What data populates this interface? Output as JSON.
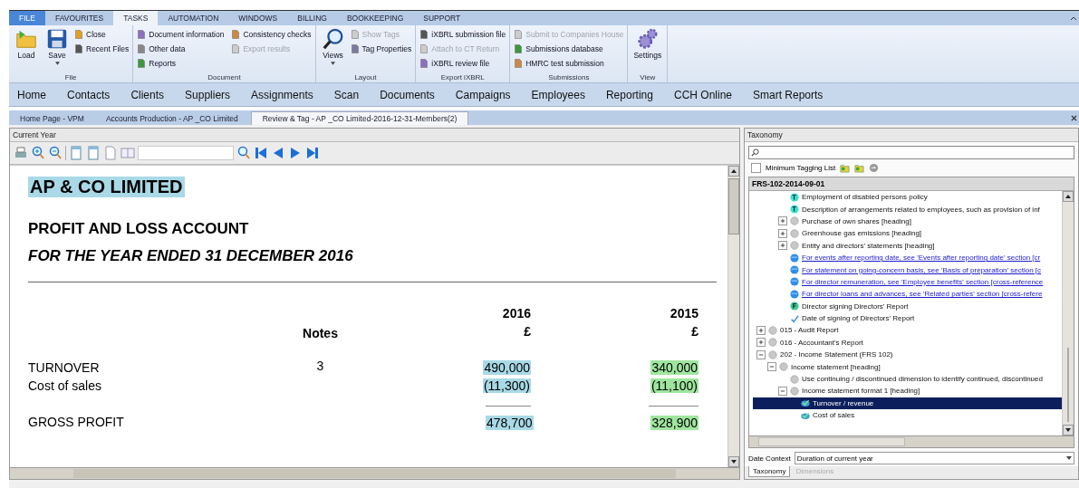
{
  "menu_tabs": [
    {
      "label": "FILE",
      "kind": "file",
      "selected": false
    },
    {
      "label": "FAVOURITES",
      "kind": "tab",
      "selected": false
    },
    {
      "label": "TASKS",
      "kind": "tab",
      "selected": true
    },
    {
      "label": "AUTOMATION",
      "kind": "tab",
      "selected": false
    },
    {
      "label": "WINDOWS",
      "kind": "tab",
      "selected": false
    },
    {
      "label": "BILLING",
      "kind": "tab",
      "selected": false
    },
    {
      "label": "BOOKKEEPING",
      "kind": "tab",
      "selected": false
    },
    {
      "label": "SUPPORT",
      "kind": "tab",
      "selected": false
    }
  ],
  "ribbon_groups": [
    {
      "label": "File",
      "buttons": [
        {
          "label": "Load",
          "kind": "large",
          "disabled": false
        },
        {
          "label": "Save",
          "kind": "large",
          "dropdown": true,
          "disabled": false
        },
        {
          "label": "Close",
          "kind": "small",
          "disabled": false
        },
        {
          "label": "Recent Files",
          "kind": "small",
          "disabled": false
        }
      ]
    },
    {
      "label": "Document",
      "buttons": [
        {
          "label": "Document information",
          "kind": "small",
          "disabled": false
        },
        {
          "label": "Other data",
          "kind": "small",
          "disabled": false
        },
        {
          "label": "Reports",
          "kind": "small",
          "disabled": false
        },
        {
          "label": "Consistency checks",
          "kind": "small",
          "disabled": false
        },
        {
          "label": "Export results",
          "kind": "small",
          "disabled": true
        }
      ]
    },
    {
      "label": "Layout",
      "buttons": [
        {
          "label": "Views",
          "kind": "large",
          "dropdown": true,
          "disabled": false
        },
        {
          "label": "Show Tags",
          "kind": "small",
          "disabled": true
        },
        {
          "label": "Tag Properties",
          "kind": "small",
          "disabled": false
        }
      ]
    },
    {
      "label": "Export iXBRL",
      "buttons": [
        {
          "label": "iXBRL submission file",
          "kind": "small",
          "disabled": false
        },
        {
          "label": "Attach to CT Return",
          "kind": "small",
          "disabled": true
        },
        {
          "label": "iXBRL review file",
          "kind": "small",
          "disabled": false
        }
      ]
    },
    {
      "label": "Submissions",
      "buttons": [
        {
          "label": "Submit to Companies House",
          "kind": "small",
          "disabled": true
        },
        {
          "label": "Submissions database",
          "kind": "small",
          "disabled": false
        },
        {
          "label": "HMRC test submission",
          "kind": "small",
          "disabled": false
        }
      ]
    },
    {
      "label": "View",
      "buttons": [
        {
          "label": "Settings",
          "kind": "large",
          "disabled": false
        }
      ]
    }
  ],
  "nav": [
    "Home",
    "Contacts",
    "Clients",
    "Suppliers",
    "Assignments",
    "Scan",
    "Documents",
    "Campaigns",
    "Employees",
    "Reporting",
    "CCH Online",
    "Smart Reports"
  ],
  "doc_tabs": [
    {
      "label": "Home Page - VPM",
      "selected": false
    },
    {
      "label": "Accounts Production - AP _CO Limited",
      "selected": false
    },
    {
      "label": "Review & Tag - AP _CO Limited-2016-12-31-Members(2)",
      "selected": true
    }
  ],
  "document": {
    "panel_title": "Current Year",
    "company": {
      "text": "AP & CO LIMITED",
      "tagged": true
    },
    "heading": "PROFIT AND LOSS ACCOUNT",
    "subheading": "FOR THE YEAR ENDED 31 DECEMBER 2016",
    "notes_label": "Notes",
    "columns": [
      {
        "year": "2016",
        "unit": "£",
        "color": "#a9d9e6"
      },
      {
        "year": "2015",
        "unit": "£",
        "color": "#9fe59f"
      }
    ],
    "rows": [
      {
        "label": "TURNOVER",
        "kind": "line",
        "note": "3",
        "values": [
          {
            "text": "490,000",
            "tagged": true
          },
          {
            "text": "340,000",
            "tagged": true
          }
        ]
      },
      {
        "label": "Cost of sales",
        "kind": "line",
        "values": [
          {
            "text": "(11,300)",
            "tagged": true
          },
          {
            "text": "(11,100)",
            "tagged": true
          }
        ]
      },
      {
        "label": "GROSS PROFIT",
        "kind": "total",
        "values": [
          {
            "text": "478,700",
            "tagged": true
          },
          {
            "text": "328,900",
            "tagged": true
          }
        ]
      }
    ]
  },
  "taxonomy": {
    "panel_title": "Taxonomy",
    "minimum_tagging_list": {
      "label": "Minimum Tagging List",
      "checked": false
    },
    "tree": {
      "root": "FRS-102-2014-09-01",
      "items": [
        {
          "children": [
            {
              "children": [
                {
                  "label": "Employment of disabled persons policy",
                  "kind": "text",
                  "selected": false
                },
                {
                  "label": "Description of arrangements related to employees, such as provision of inf",
                  "kind": "text",
                  "selected": false
                },
                {
                  "label": "Purchase of own shares [heading]",
                  "kind": "heading",
                  "expanded": false,
                  "selected": false
                },
                {
                  "label": "Greenhouse gas emissions [heading]",
                  "kind": "heading",
                  "expanded": false,
                  "selected": false
                },
                {
                  "label": "Entity and directors' statements [heading]",
                  "kind": "heading",
                  "expanded": false,
                  "selected": false
                },
                {
                  "label": "For events after reporting date, see 'Events after reporting date' section [cr",
                  "kind": "link",
                  "selected": false
                },
                {
                  "label": "For statement on going-concern basis, see 'Basis of preparation' section [c",
                  "kind": "link",
                  "selected": false
                },
                {
                  "label": "For director remuneration, see 'Employee benefits' section [cross-reference",
                  "kind": "link",
                  "selected": false
                },
                {
                  "label": "For director loans and advances, see 'Related parties' section [cross-refere",
                  "kind": "link",
                  "selected": false
                },
                {
                  "label": "Director signing Directors' Report",
                  "kind": "fact",
                  "selected": false
                },
                {
                  "label": "Date of signing of Directors' Report",
                  "kind": "date",
                  "selected": false
                }
              ]
            }
          ]
        },
        {
          "label": "015 - Audit Report",
          "kind": "heading",
          "expanded": false,
          "selected": false
        },
        {
          "label": "016 - Accountant's Report",
          "kind": "heading",
          "expanded": false,
          "selected": false
        },
        {
          "label": "202 - Income Statement (FRS 102)",
          "kind": "heading",
          "expanded": true,
          "selected": false,
          "children": [
            {
              "label": "Income statement [heading]",
              "kind": "heading",
              "expanded": true,
              "selected": false,
              "children": [
                {
                  "label": "Use continuing / discontinued dimension to identify continued, discontinued",
                  "kind": "heading",
                  "selected": false
                },
                {
                  "label": "Income statement format 1 [heading]",
                  "kind": "heading",
                  "expanded": true,
                  "selected": false,
                  "children": [
                    {
                      "label": "Turnover / revenue",
                      "kind": "tagged",
                      "selected": true
                    },
                    {
                      "label": "Cost of sales",
                      "kind": "tagged",
                      "selected": false
                    }
                  ]
                }
              ]
            }
          ]
        }
      ]
    },
    "date_context": {
      "label": "Date Context",
      "value": "Duration of current year"
    },
    "bottom_tabs": [
      {
        "label": "Taxonomy",
        "selected": true
      },
      {
        "label": "Dimensions",
        "selected": false
      }
    ]
  }
}
